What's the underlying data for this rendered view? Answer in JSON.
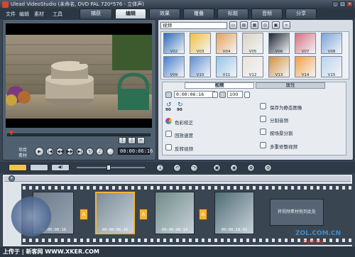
{
  "titlebar": {
    "title": "Ulead VideoStudio (未命名, DVD PAL 720*576 - 立体声)",
    "minimize": "_",
    "maximize": "□",
    "close": "×"
  },
  "menu": [
    "文件",
    "编辑",
    "素材",
    "工具"
  ],
  "steps": [
    "捕获",
    "编辑",
    "效果",
    "覆叠",
    "标题",
    "音频",
    "分享"
  ],
  "active_step": "编辑",
  "player": {
    "mode_labels": [
      "项目",
      "素材"
    ],
    "timecode": "00:00:06:16",
    "controls": {
      "play": "▶",
      "home": "|◀",
      "prev": "◀◀",
      "next": "▶▶",
      "end": "▶|",
      "repeat": "↻",
      "volume": "♪"
    },
    "trim": {
      "mark_in": "[",
      "mark_out": "]",
      "cut": "✂"
    }
  },
  "library": {
    "category": "视频",
    "tools": [
      "folder-icon",
      "import-icon",
      "grid-icon",
      "sort-icon",
      "options-icon",
      "expand-icon"
    ],
    "thumbs": [
      "V02",
      "V03",
      "V04",
      "V05",
      "V06",
      "V07",
      "V08",
      "V09",
      "V10",
      "V11",
      "V12",
      "V13",
      "V14",
      "V15"
    ],
    "thumb_colors": [
      "#2f6ab8",
      "#f0c040",
      "#e8a058",
      "#d9d2c0",
      "#1c2430",
      "#d86f80",
      "#7aa3d8",
      "#4a7fcb",
      "#5f8fd1",
      "#97c4e8",
      "#e9e3d6",
      "#d29040",
      "#f3a040",
      "#b9d3ef"
    ]
  },
  "options": {
    "tabs": [
      "视频",
      "属性"
    ],
    "duration": "0:00:06:16",
    "volume": "100",
    "rotate_left": "90",
    "rotate_right": "90",
    "items_left": [
      "色彩校正",
      "回放速度",
      "反转视频"
    ],
    "items_right": [
      "保存为静态图像",
      "分割音频",
      "按场景分割",
      "多重修整视频"
    ]
  },
  "timeline": {
    "clips": [
      {
        "time": "00:00:06:16",
        "color": "#7c8c96"
      },
      {
        "time": "00:00:08:14",
        "color": "#6f8b88"
      },
      {
        "time": "00:00:18:02",
        "color": "#4f6c74"
      }
    ],
    "placeholder": "将视频素材拖到此处",
    "first_clip_time": "00:00:06:16"
  },
  "watermarks": {
    "left": "上传于 | 新客网 WWW.XKER.COM",
    "right": "ZOL.COM.CN",
    "right_sub": "中关村在线"
  }
}
